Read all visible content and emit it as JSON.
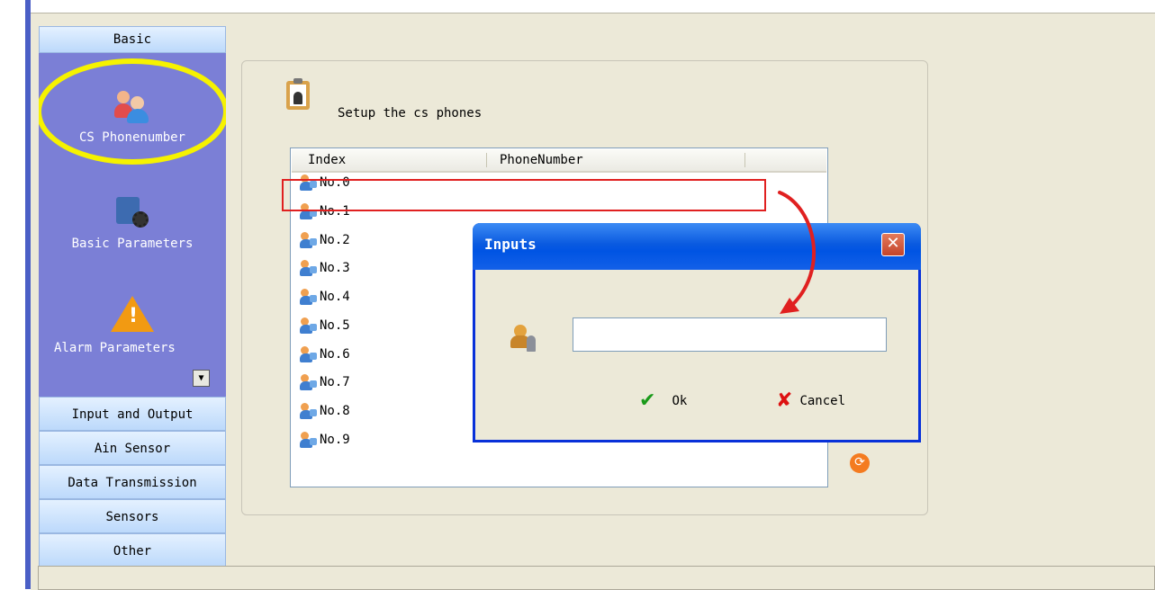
{
  "sidebar": {
    "categories": {
      "basic": "Basic",
      "input_output": "Input and Output",
      "ain_sensor": "Ain Sensor",
      "data_transmission": "Data Transmission",
      "sensors": "Sensors",
      "other": "Other"
    },
    "items": [
      {
        "label": "CS Phonenumber",
        "icon": "users-icon"
      },
      {
        "label": "Basic Parameters",
        "icon": "settings-gear-icon"
      },
      {
        "label": "Alarm Parameters",
        "icon": "warning-icon"
      }
    ]
  },
  "main": {
    "title": "Setup the cs phones",
    "columns": [
      "Index",
      "PhoneNumber"
    ],
    "rows": [
      "No.0",
      "No.1",
      "No.2",
      "No.3",
      "No.4",
      "No.5",
      "No.6",
      "No.7",
      "No.8",
      "No.9"
    ]
  },
  "dialog": {
    "title": "Inputs",
    "input_value": "",
    "ok_label": "Ok",
    "cancel_label": "Cancel"
  },
  "colors": {
    "sidebar_panel": "#7b7fd6",
    "highlight_ellipse": "#f6f200",
    "annotation_red": "#e02020",
    "dialog_title": "#0054e3"
  }
}
